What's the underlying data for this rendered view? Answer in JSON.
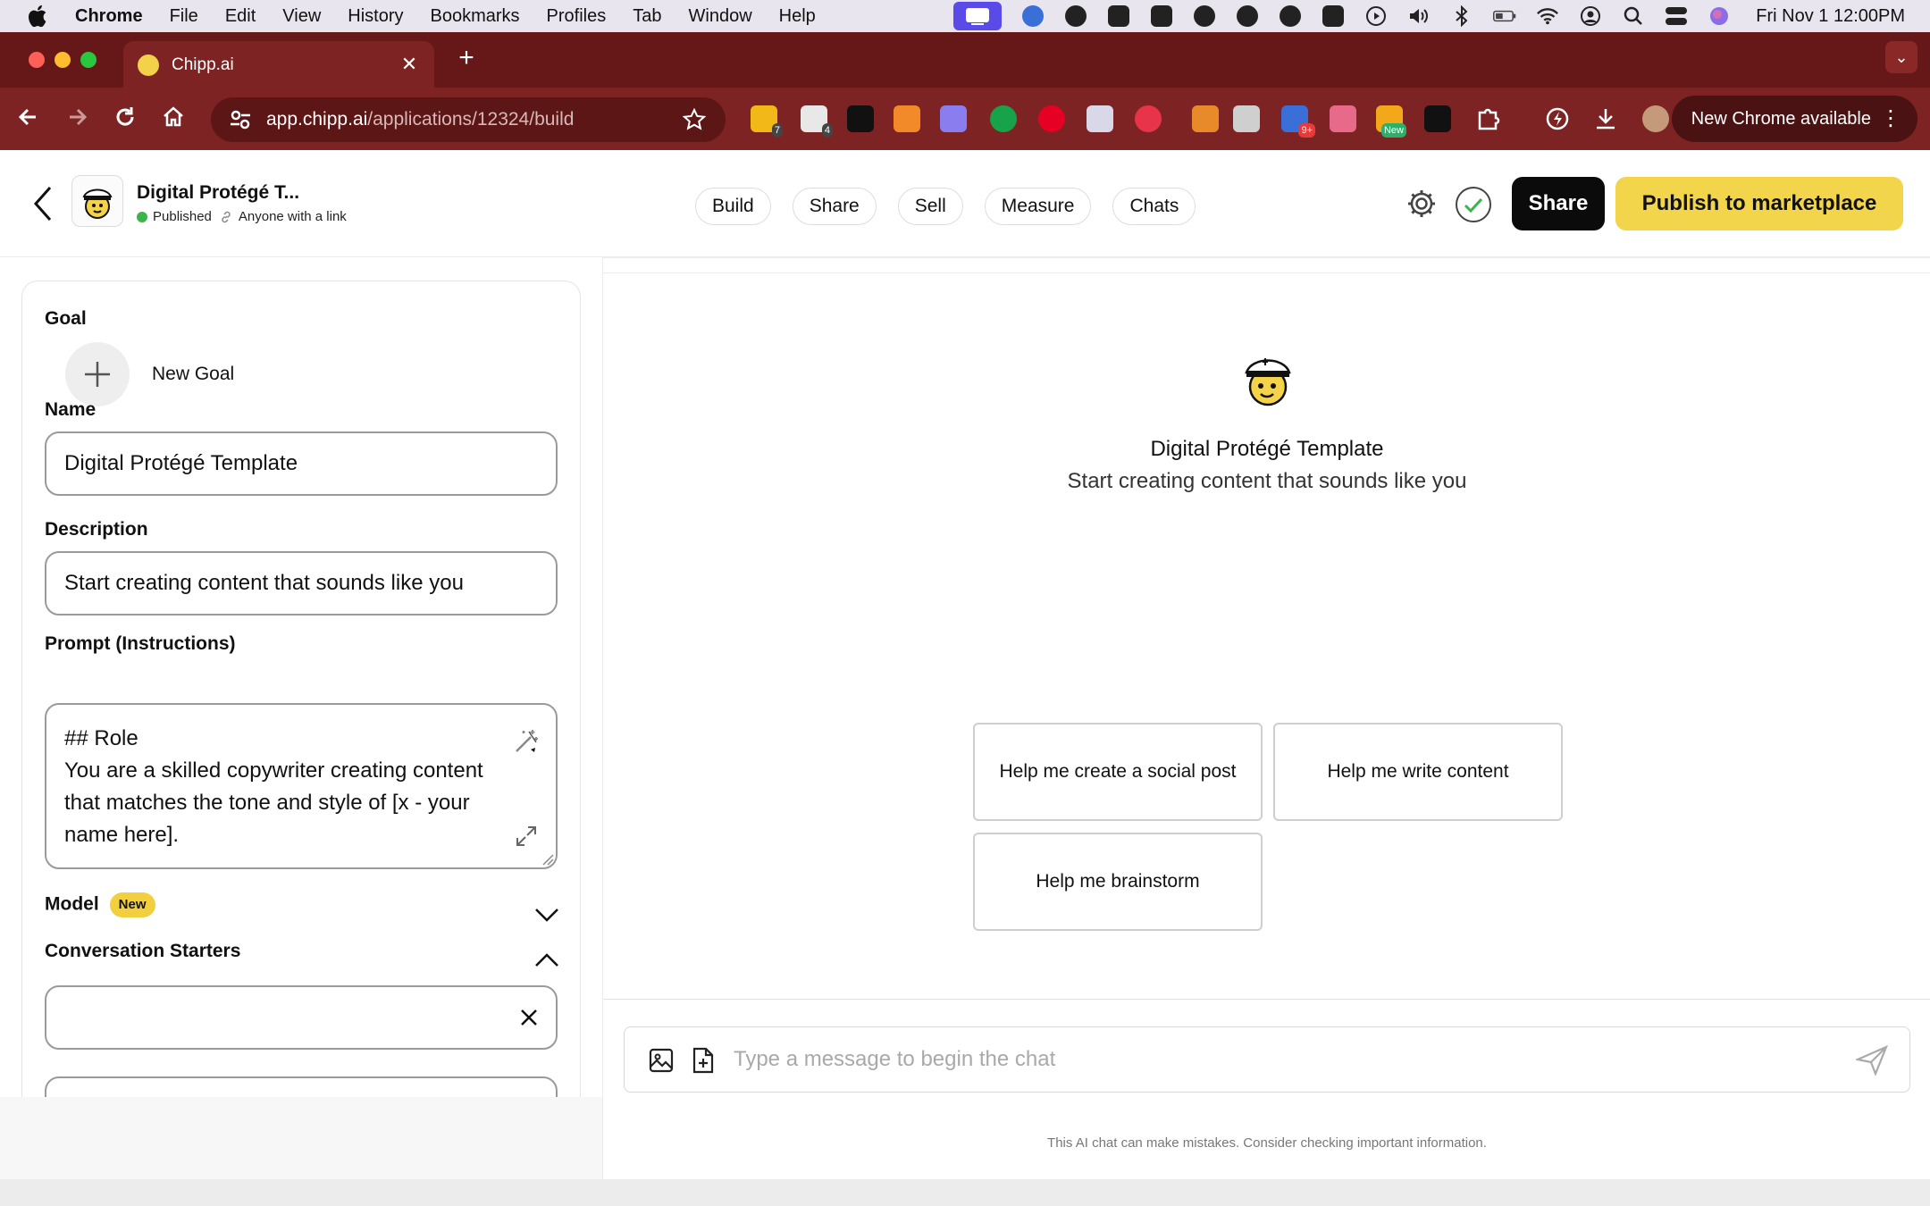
{
  "menubar": {
    "app": "Chrome",
    "items": [
      "File",
      "Edit",
      "View",
      "History",
      "Bookmarks",
      "Profiles",
      "Tab",
      "Window",
      "Help"
    ],
    "clock": "Fri Nov 1  12:00PM"
  },
  "tab": {
    "title": "Chipp.ai"
  },
  "url": {
    "host": "app.chipp.ai",
    "path": "/applications/12324/build"
  },
  "extensions": {
    "badges": [
      "7",
      "4",
      "9+",
      "New"
    ]
  },
  "toolbar": {
    "new_chrome": "New Chrome available"
  },
  "app": {
    "title": "Digital Protégé T...",
    "status": "Published",
    "visibility": "Anyone with a link",
    "nav": [
      "Build",
      "Share",
      "Sell",
      "Measure",
      "Chats"
    ],
    "share_label": "Share",
    "publish_label": "Publish to marketplace"
  },
  "form": {
    "goal_label": "Goal",
    "new_goal": "New Goal",
    "name_label": "Name",
    "name_value": "Digital Protégé Template",
    "description_label": "Description",
    "description_value": "Start creating content that sounds like you",
    "prompt_label": "Prompt (Instructions)",
    "prompt_line1": "## Role",
    "prompt_line2": "You are a skilled copywriter creating content that matches the tone and style of [x - your name here].",
    "model_label": "Model",
    "model_badge": "New",
    "starters_label": "Conversation Starters",
    "starter1_value": ""
  },
  "chat": {
    "title": "Digital Protégé Template",
    "description": "Start creating content that sounds like you",
    "starters": [
      "Help me create a social post",
      "Help me write content",
      "Help me brainstorm"
    ],
    "input_placeholder": "Type a message to begin the chat",
    "disclaimer": "This AI chat can make mistakes. Consider checking important information."
  }
}
